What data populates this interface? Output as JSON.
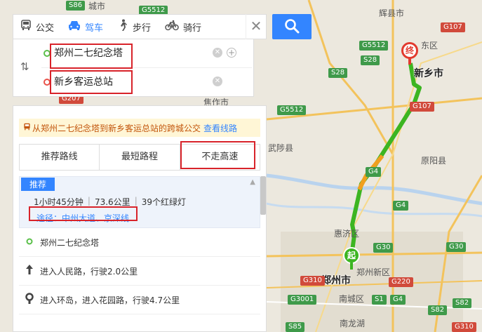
{
  "mode_tabs": [
    {
      "label": "公交",
      "icon": "bus-icon",
      "active": false
    },
    {
      "label": "驾车",
      "icon": "car-icon",
      "active": true
    },
    {
      "label": "步行",
      "icon": "walk-icon",
      "active": false
    },
    {
      "label": "骑行",
      "icon": "bike-icon",
      "active": false
    }
  ],
  "inputs": {
    "start_value": "郑州二七纪念塔",
    "end_value": "新乡客运总站"
  },
  "results": {
    "intercity_text": "从郑州二七纪念塔到新乡客运总站的跨城公交",
    "intercity_link": "查看线路",
    "route_tabs": [
      "推荐路线",
      "最短路程",
      "不走高速"
    ],
    "plan": {
      "badge": "推荐",
      "duration": "1小时45分钟",
      "distance": "73.6公里",
      "lights": "39个红绿灯",
      "via": "途径：中州大道、京深线"
    },
    "steps": [
      {
        "icon": "start-dot-icon",
        "text": "郑州二七纪念塔"
      },
      {
        "icon": "arrow-up-icon",
        "text": "进入人民路，行驶2.0公里"
      },
      {
        "icon": "roundabout-icon",
        "text": "进入环岛，进入花园路，行驶4.7公里"
      }
    ]
  },
  "map": {
    "start_marker": "起",
    "end_marker": "终",
    "places": [
      {
        "name": "辉县市",
        "style": "normal"
      },
      {
        "name": "东区",
        "style": "normal"
      },
      {
        "name": "新乡市",
        "style": "big"
      },
      {
        "name": "焦作市",
        "style": "normal"
      },
      {
        "name": "原阳县",
        "style": "normal"
      },
      {
        "name": "武陟县",
        "style": "normal"
      },
      {
        "name": "惠济区",
        "style": "normal"
      },
      {
        "name": "郑州新区",
        "style": "normal"
      },
      {
        "name": "郑州市",
        "style": "big"
      },
      {
        "name": "南城区",
        "style": "normal"
      },
      {
        "name": "南龙湖",
        "style": "normal"
      },
      {
        "name": "城市",
        "style": "normal"
      }
    ],
    "shields": [
      {
        "name": "S86",
        "color": "g"
      },
      {
        "name": "G5512",
        "color": "g"
      },
      {
        "name": "G107",
        "color": "red"
      },
      {
        "name": "G5512",
        "color": "g"
      },
      {
        "name": "S28",
        "color": "g"
      },
      {
        "name": "S28",
        "color": "g"
      },
      {
        "name": "G207",
        "color": "red"
      },
      {
        "name": "G5512",
        "color": "g"
      },
      {
        "name": "G107",
        "color": "red"
      },
      {
        "name": "G4",
        "color": "g"
      },
      {
        "name": "G4",
        "color": "g"
      },
      {
        "name": "G30",
        "color": "g"
      },
      {
        "name": "G30",
        "color": "g"
      },
      {
        "name": "G310",
        "color": "red"
      },
      {
        "name": "G220",
        "color": "red"
      },
      {
        "name": "G3001",
        "color": "g"
      },
      {
        "name": "S1",
        "color": "g"
      },
      {
        "name": "G4",
        "color": "g"
      },
      {
        "name": "S82",
        "color": "g"
      },
      {
        "name": "S82",
        "color": "g"
      },
      {
        "name": "S85",
        "color": "g"
      },
      {
        "name": "G310",
        "color": "red"
      }
    ]
  },
  "colors": {
    "accent": "#3385ff",
    "route": "#3cb521",
    "highlight": "#d8232a"
  }
}
